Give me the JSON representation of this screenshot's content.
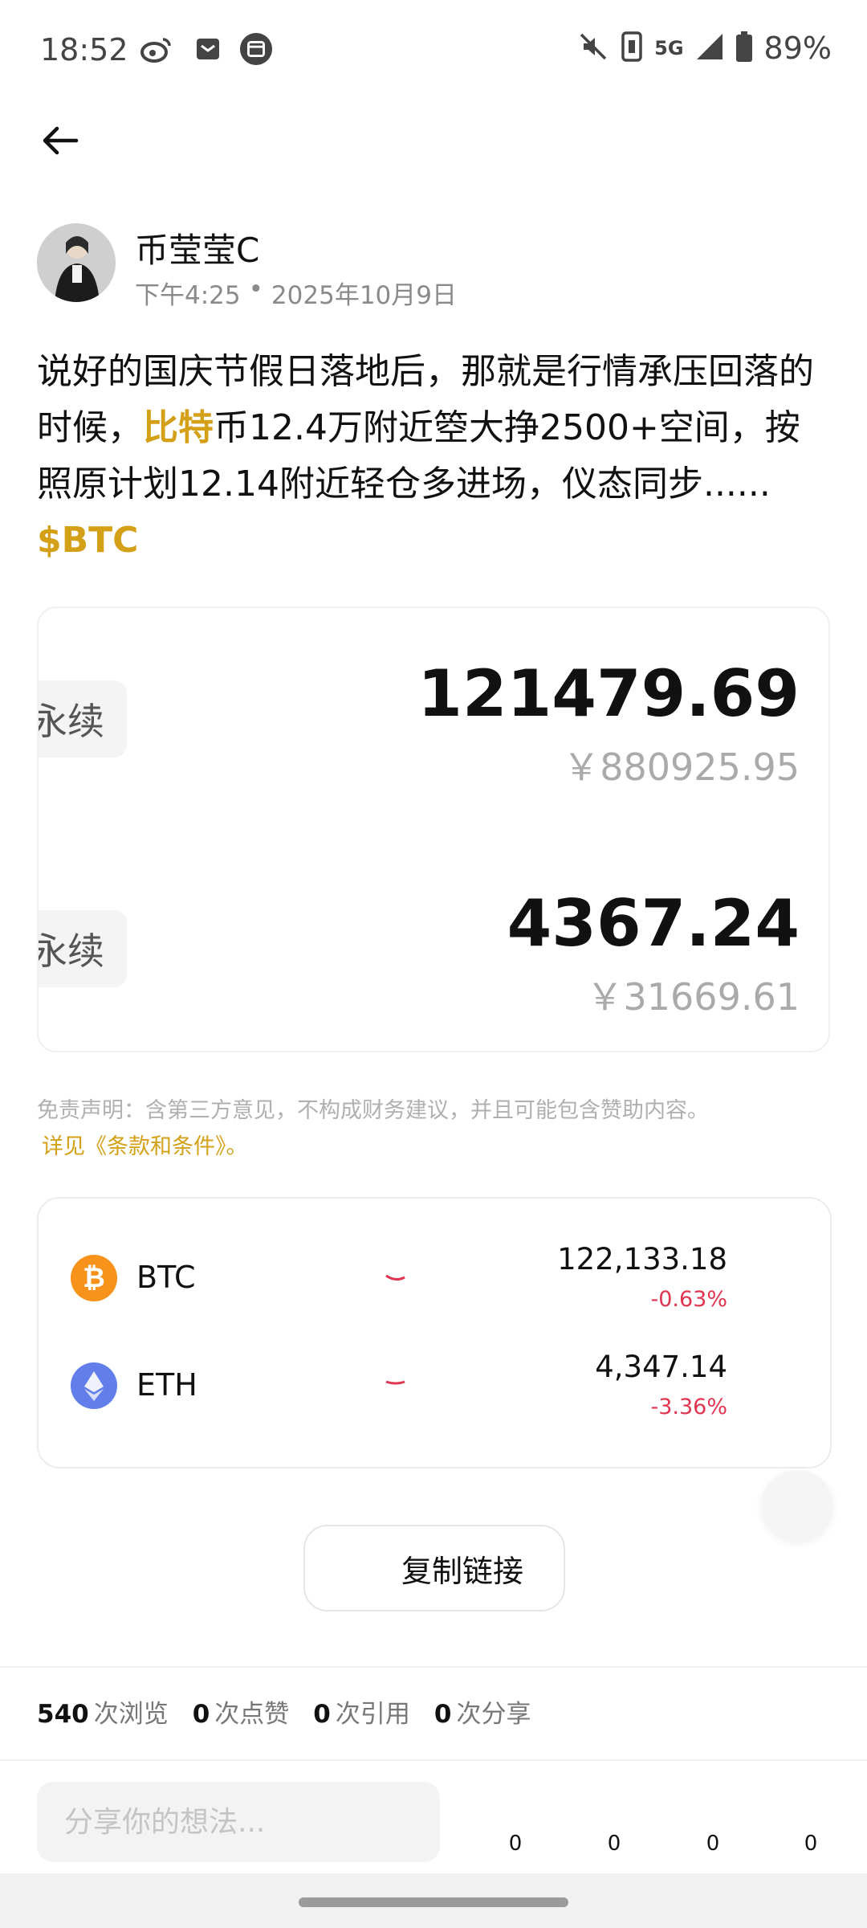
{
  "status_bar": {
    "time": "18:52",
    "battery": "89%",
    "network": "5G",
    "left_icons": [
      "weibo-icon",
      "mail-icon",
      "calendar-icon"
    ],
    "right_icons": [
      "mute-icon",
      "nfc-icon",
      "signal-icon",
      "battery-icon"
    ]
  },
  "post": {
    "author": "币莹莹C",
    "time": "下午4:25",
    "date": "2025年10月9日",
    "text_1": "说好的国庆节假日落地后，那就是行情承压回落的时候，",
    "highlight_1": "比特",
    "text_2": "币12.4万附近箜大挣2500+空间，按照原计划12.14附近轻仓多进场，仪态同步...... ",
    "cashtag": "$BTC"
  },
  "tickers": [
    {
      "label": "永续",
      "price": "121479.69",
      "price_cny": "￥880925.95"
    },
    {
      "label": "永续",
      "price": "4367.24",
      "price_cny": "￥31669.61"
    }
  ],
  "disclaimer": {
    "text": "免责声明：含第三方意见，不构成财务建议，并且可能包含赞助内容。",
    "link": "详见《条款和条件》。"
  },
  "market": [
    {
      "symbol": "BTC",
      "price": "122,133.18",
      "change": "-0.63%",
      "icon": "bitcoin-icon",
      "color": "#f7931a"
    },
    {
      "symbol": "ETH",
      "price": "4,347.14",
      "change": "-3.36%",
      "icon": "ethereum-icon",
      "color": "#627eea"
    }
  ],
  "copy_link_label": "复制链接",
  "stats": [
    {
      "count": "540",
      "label": "次浏览"
    },
    {
      "count": "0",
      "label": "次点赞"
    },
    {
      "count": "0",
      "label": "次引用"
    },
    {
      "count": "0",
      "label": "次分享"
    }
  ],
  "reply": {
    "placeholder": "分享你的想法..."
  },
  "action_counts": [
    "0",
    "0",
    "0",
    "0"
  ],
  "colors": {
    "accent": "#d4a017",
    "negative": "#e0344f"
  }
}
